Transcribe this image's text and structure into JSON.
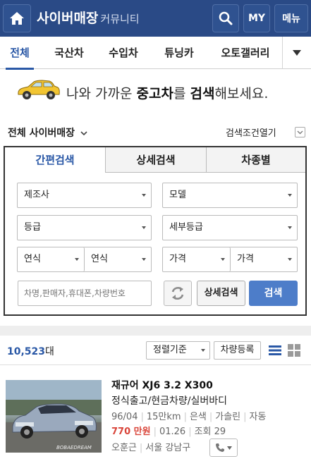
{
  "header": {
    "title": "사이버매장",
    "subtitle": "커뮤니티",
    "my_label": "MY",
    "menu_label": "메뉴"
  },
  "tabs": [
    {
      "label": "전체"
    },
    {
      "label": "국산차"
    },
    {
      "label": "수입차"
    },
    {
      "label": "튜닝카"
    },
    {
      "label": "오토갤러리"
    }
  ],
  "promo": {
    "pre": "나와 가까운 ",
    "b1": "중고차",
    "mid": "를 ",
    "b2": "검색",
    "post": "해보세요."
  },
  "market": {
    "label": "전체 사이버매장",
    "open_conditions": "검색조건열기"
  },
  "search_panel": {
    "tabs": [
      {
        "label": "간편검색"
      },
      {
        "label": "상세검색"
      },
      {
        "label": "차종별"
      }
    ],
    "maker": "제조사",
    "model": "모델",
    "grade": "등급",
    "sub_grade": "세부등급",
    "year_from": "연식",
    "year_to": "연식",
    "price_from": "가격",
    "price_to": "가격",
    "keyword_placeholder": "차명,판매자,휴대폰,차량번호",
    "detail_button": "상세검색",
    "search_button": "검색"
  },
  "list": {
    "count": "10,523",
    "count_unit": "대",
    "sort_label": "정렬기준",
    "register_label": "차량등록"
  },
  "car": {
    "title1": "재규어 XJ6 3.2 X300",
    "title2": "정식출고/현금차량/실버바디",
    "year": "96/04",
    "mileage": "15만km",
    "color": "은색",
    "fuel": "가솔린",
    "transmission": "자동",
    "price": "770 만원",
    "date": "01.26",
    "views": "조회 29",
    "seller": "오훈근",
    "location": "서울 강남구",
    "thumb_caption": "BOBAEDREAM"
  },
  "colors": {
    "header": "#2a4a86",
    "accent": "#2a58a6",
    "search_button": "#4d7dc9",
    "price": "#d9453a"
  }
}
